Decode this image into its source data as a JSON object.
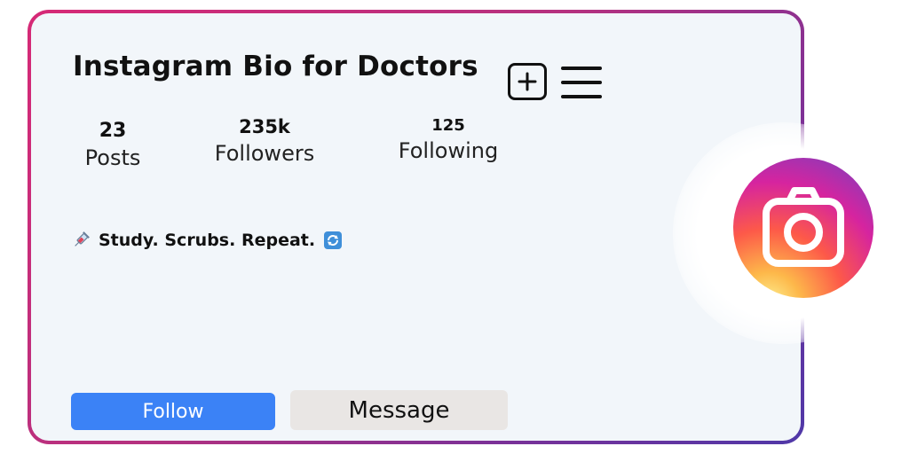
{
  "profile": {
    "title": "Instagram Bio for Doctors",
    "stats": [
      {
        "value": "23",
        "label": "Posts"
      },
      {
        "value": "235k",
        "label": "Followers"
      },
      {
        "value": "125",
        "label": "Following"
      }
    ],
    "bio": {
      "text": "Study. Scrubs. Repeat.",
      "leading_icon": "syringe-icon",
      "trailing_icon": "refresh-icon"
    }
  },
  "actions": {
    "follow_label": "Follow",
    "message_label": "Message"
  },
  "icons": {
    "add": "add-post-icon",
    "menu": "hamburger-menu-icon",
    "badge": "instagram-camera-icon"
  },
  "colors": {
    "follow_button": "#3b82f6",
    "message_button": "#e9e6e4",
    "card_background": "#f2f6fa",
    "border_start": "#d62976",
    "border_end": "#4f38a8"
  }
}
